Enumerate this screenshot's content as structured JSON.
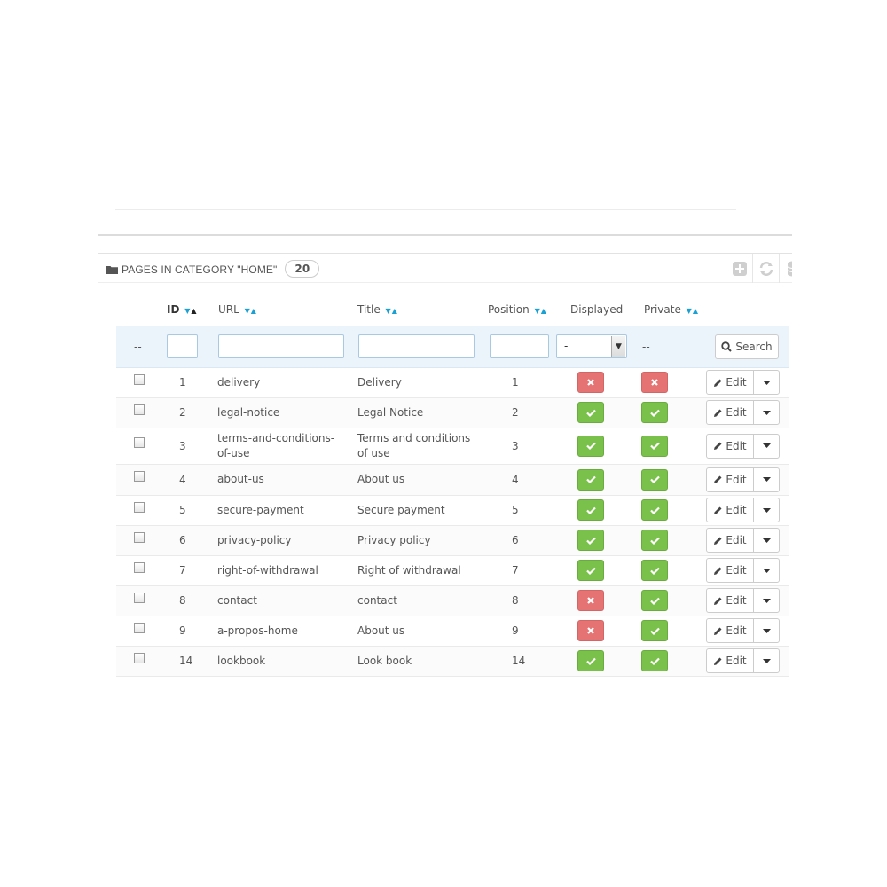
{
  "panel": {
    "title": "PAGES IN CATEGORY \"HOME\"",
    "count": "20",
    "tools": [
      "add-icon",
      "refresh-icon",
      "database-icon"
    ]
  },
  "columns": {
    "id": "ID",
    "url": "URL",
    "title": "Title",
    "position": "Position",
    "displayed": "Displayed",
    "private": "Private"
  },
  "filters": {
    "select_label": "--",
    "displayed_value": "-",
    "private_placeholder": "--",
    "search_label": "Search"
  },
  "colors": {
    "yes": "#79c14a",
    "no": "#e57373",
    "accent": "#1ba0d3",
    "filter_bg": "#ebf4fb"
  },
  "actions": {
    "edit_label": "Edit"
  },
  "rows": [
    {
      "id": "1",
      "url": "delivery",
      "title": "Delivery",
      "position": "1",
      "displayed": false,
      "private": false
    },
    {
      "id": "2",
      "url": "legal-notice",
      "title": "Legal Notice",
      "position": "2",
      "displayed": true,
      "private": true
    },
    {
      "id": "3",
      "url": "terms-and-conditions-of-use",
      "title": "Terms and conditions of use",
      "position": "3",
      "displayed": true,
      "private": true
    },
    {
      "id": "4",
      "url": "about-us",
      "title": "About us",
      "position": "4",
      "displayed": true,
      "private": true
    },
    {
      "id": "5",
      "url": "secure-payment",
      "title": "Secure payment",
      "position": "5",
      "displayed": true,
      "private": true
    },
    {
      "id": "6",
      "url": "privacy-policy",
      "title": "Privacy policy",
      "position": "6",
      "displayed": true,
      "private": true
    },
    {
      "id": "7",
      "url": "right-of-withdrawal",
      "title": "Right of withdrawal",
      "position": "7",
      "displayed": true,
      "private": true
    },
    {
      "id": "8",
      "url": "contact",
      "title": "contact",
      "position": "8",
      "displayed": false,
      "private": true
    },
    {
      "id": "9",
      "url": "a-propos-home",
      "title": "About us",
      "position": "9",
      "displayed": false,
      "private": true
    },
    {
      "id": "14",
      "url": "lookbook",
      "title": "Look book",
      "position": "14",
      "displayed": true,
      "private": true
    }
  ]
}
